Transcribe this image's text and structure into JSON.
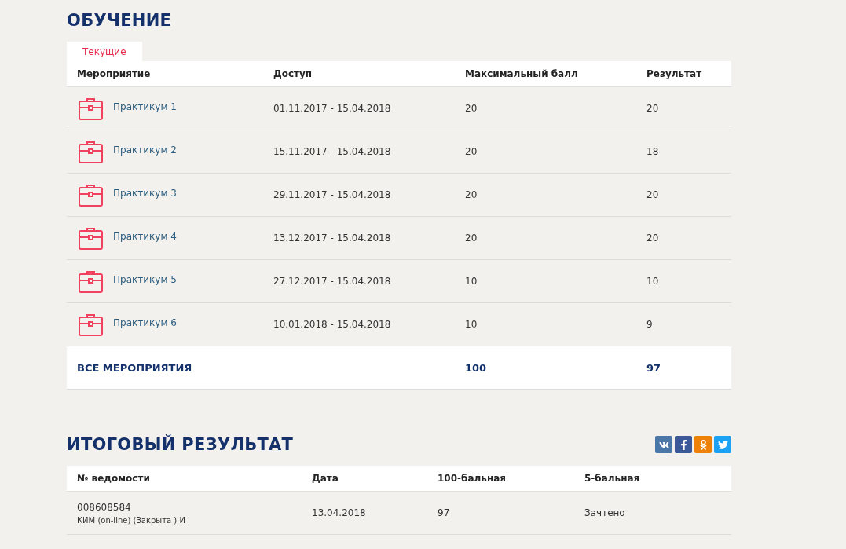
{
  "learning": {
    "title": "ОБУЧЕНИЕ",
    "tabs": [
      {
        "label": "Текущие",
        "selected": true
      }
    ],
    "columns": [
      "Мероприятие",
      "Доступ",
      "Максимальный балл",
      "Результат"
    ],
    "rows": [
      {
        "name": "Практикум 1",
        "access": "01.11.2017 - 15.04.2018",
        "max": "20",
        "result": "20"
      },
      {
        "name": "Практикум 2",
        "access": "15.11.2017 - 15.04.2018",
        "max": "20",
        "result": "18"
      },
      {
        "name": "Практикум 3",
        "access": "29.11.2017 - 15.04.2018",
        "max": "20",
        "result": "20"
      },
      {
        "name": "Практикум 4",
        "access": "13.12.2017 - 15.04.2018",
        "max": "20",
        "result": "20"
      },
      {
        "name": "Практикум 5",
        "access": "27.12.2017 - 15.04.2018",
        "max": "10",
        "result": "10"
      },
      {
        "name": "Практикум 6",
        "access": "10.01.2018 - 15.04.2018",
        "max": "10",
        "result": "9"
      }
    ],
    "total": {
      "label": "ВСЕ МЕРОПРИЯТИЯ",
      "max": "100",
      "result": "97"
    }
  },
  "final": {
    "title": "ИТОГОВЫЙ РЕЗУЛЬТАТ",
    "share": [
      {
        "kind": "vk",
        "color": "#4a76a8"
      },
      {
        "kind": "facebook",
        "color": "#3b5998"
      },
      {
        "kind": "ok",
        "color": "#ee8208"
      },
      {
        "kind": "twitter",
        "color": "#1da1f2"
      }
    ],
    "columns": [
      "№ ведомости",
      "Дата",
      "100-бальная",
      "5-бальная"
    ],
    "rows": [
      {
        "number": "008608584",
        "note": "КИМ (on-line) (Закрыта ) И",
        "date": "13.04.2018",
        "score100": "97",
        "score5": "Зачтено"
      }
    ]
  }
}
